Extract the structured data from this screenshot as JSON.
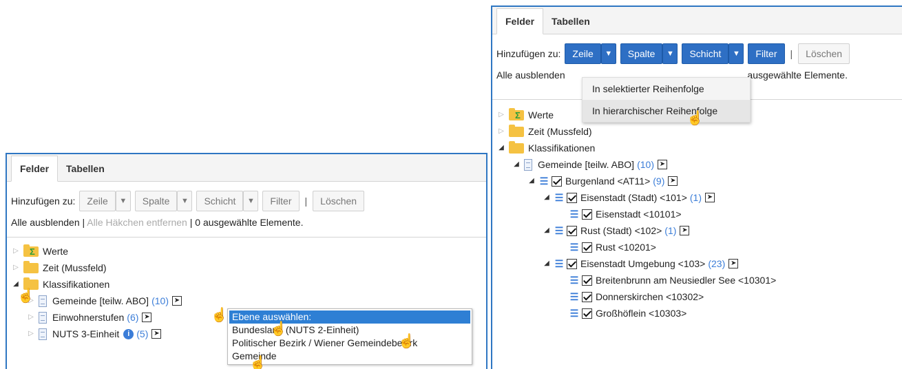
{
  "left": {
    "tabs": [
      "Felder",
      "Tabellen"
    ],
    "toolbar": {
      "label": "Hinzufügen zu:",
      "zeile": "Zeile",
      "spalte": "Spalte",
      "schicht": "Schicht",
      "filter": "Filter",
      "sep": "|",
      "loeschen": "Löschen"
    },
    "info": {
      "hide_all": "Alle ausblenden",
      "sep": "|",
      "remove_checks": "Alle Häkchen entfernen",
      "selected": "0 ausgewählte Elemente."
    },
    "tree": {
      "werte": "Werte",
      "zeit": "Zeit (Mussfeld)",
      "klass": "Klassifikationen",
      "gemeinde": "Gemeinde [teilw. ABO]",
      "gemeinde_count": "(10)",
      "einwohner": "Einwohnerstufen",
      "einwohner_count": "(6)",
      "nuts3": "NUTS 3-Einheit",
      "nuts3_count": "(5)"
    },
    "dropdown": {
      "items": [
        "Ebene auswählen:",
        "Bundesland (NUTS 2-Einheit)",
        "Politischer Bezirk / Wiener Gemeindebezirk",
        "Gemeinde"
      ]
    }
  },
  "right": {
    "tabs": [
      "Felder",
      "Tabellen"
    ],
    "toolbar": {
      "label": "Hinzufügen zu:",
      "zeile": "Zeile",
      "spalte": "Spalte",
      "schicht": "Schicht",
      "filter": "Filter",
      "sep": "|",
      "loeschen": "Löschen"
    },
    "info": {
      "hide_all": "Alle ausblenden",
      "selected": "ausgewählte Elemente."
    },
    "popup": {
      "items": [
        "In selektierter Reihenfolge",
        "In hierarchischer Reihenfolge"
      ]
    },
    "tree": {
      "werte": "Werte",
      "zeit": "Zeit (Mussfeld)",
      "klass": "Klassifikationen",
      "gemeinde": "Gemeinde [teilw. ABO]",
      "gemeinde_count": "(10)",
      "burgenland": "Burgenland <AT11>",
      "burgenland_count": "(9)",
      "eisenstadt_stadt": "Eisenstadt (Stadt) <101>",
      "eisenstadt_stadt_count": "(1)",
      "eisenstadt": "Eisenstadt <10101>",
      "rust_stadt": "Rust (Stadt) <102>",
      "rust_stadt_count": "(1)",
      "rust": "Rust <10201>",
      "umgebung": "Eisenstadt Umgebung <103>",
      "umgebung_count": "(23)",
      "breitenbrunn": "Breitenbrunn am Neusiedler See <10301>",
      "donnerskirchen": "Donnerskirchen <10302>",
      "grosshoeflein": "Großhöflein <10303>"
    }
  },
  "colors": {
    "accent": "#2e6fc4",
    "border": "#2e76c2",
    "count": "#3b7dd8",
    "folder": "#f5c242"
  },
  "icons": {
    "folder": "folder-icon",
    "document": "document-icon",
    "expand": "triangle-icon",
    "submenu": "arrow-right-icon",
    "cursor": "hand-cursor-icon"
  }
}
